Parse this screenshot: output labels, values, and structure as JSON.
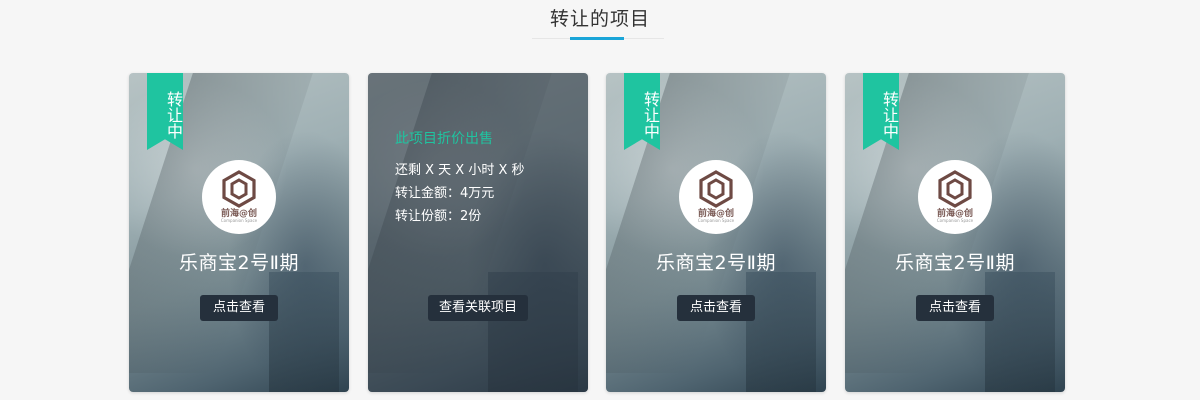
{
  "section": {
    "title": "转让的项目"
  },
  "colors": {
    "accent": "#1aa5d8",
    "ribbon": "#1fc4a0",
    "button_bg": "#25303c"
  },
  "cards": [
    {
      "ribbon": "转让中",
      "logo_name": "前海@创",
      "logo_sub": "Companion Space",
      "title": "乐商宝2号Ⅱ期",
      "button": "点击查看"
    },
    {
      "headline": "此项目折价出售",
      "remaining": "还剩 X 天 X 小时 X 秒",
      "amount": "转让金额：4万元",
      "shares": "转让份额：2份",
      "button": "查看关联项目"
    },
    {
      "ribbon": "转让中",
      "logo_name": "前海@创",
      "logo_sub": "Companion Space",
      "title": "乐商宝2号Ⅱ期",
      "button": "点击查看"
    },
    {
      "ribbon": "转让中",
      "logo_name": "前海@创",
      "logo_sub": "Companion Space",
      "title": "乐商宝2号Ⅱ期",
      "button": "点击查看"
    }
  ]
}
